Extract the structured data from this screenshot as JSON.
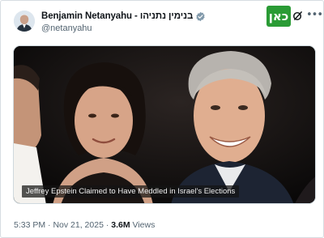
{
  "author": {
    "display_name": "Benjamin Netanyahu - בנימין נתניהו",
    "handle": "@netanyahu"
  },
  "badges": {
    "verified_icon": "verified-badge-icon",
    "brand_logo_text": "כאן",
    "brand_logo_color": "#2a9b35"
  },
  "media": {
    "caption": "Jeffrey Epstein Claimed to Have Meddled in Israel's Elections"
  },
  "meta": {
    "time": "5:33 PM",
    "separator": "·",
    "date": "Nov 21, 2025",
    "views_count": "3.6M",
    "views_label": "Views"
  },
  "colors": {
    "accent": "#1d9bf0",
    "text_secondary": "#536471"
  }
}
